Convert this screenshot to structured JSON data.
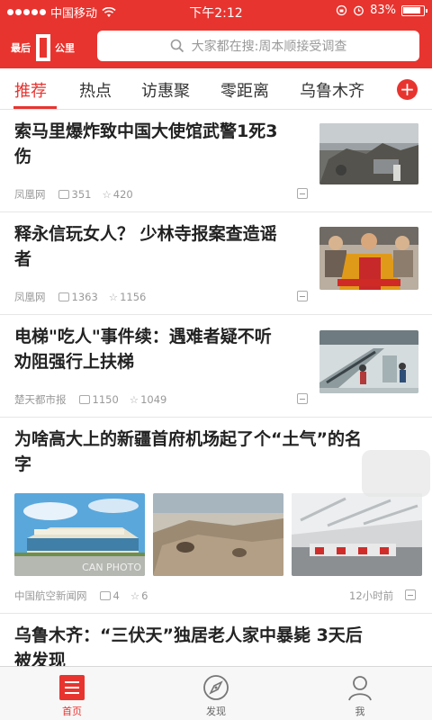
{
  "status_bar": {
    "carrier": "中国移动",
    "time": "下午2:12",
    "battery": "83%",
    "battery_level": 0.83
  },
  "header": {
    "logo_text_left": "最后",
    "logo_text_right": "公里",
    "search_placeholder": "大家都在搜:周本顺接受调查"
  },
  "tabs": [
    {
      "label": "推荐",
      "active": true
    },
    {
      "label": "热点",
      "active": false
    },
    {
      "label": "访惠聚",
      "active": false
    },
    {
      "label": "零距离",
      "active": false
    },
    {
      "label": "乌鲁木齐",
      "active": false
    }
  ],
  "accent_color": "#e8342f",
  "news": [
    {
      "title_line1": "索马里爆炸致中国大使馆武警1死3",
      "title_line2": "伤",
      "source": "凤凰网",
      "comments": "351",
      "likes": "420"
    },
    {
      "title_line1": "释永信玩女人？ 少林寺报案查造谣",
      "title_line2": "者",
      "source": "凤凰网",
      "comments": "1363",
      "likes": "1156"
    },
    {
      "title_line1": "电梯\"吃人\"事件续：遇难者疑不听",
      "title_line2": "劝阻强行上扶梯",
      "source": "楚天都市报",
      "comments": "1150",
      "likes": "1049"
    },
    {
      "title_line1": "为啥高大上的新疆首府机场起了个“土气”的名",
      "title_line2": "字",
      "source": "中国航空新闻网",
      "comments": "4",
      "likes": "6",
      "time": "12小时前",
      "watermark": "CAN PHOTO"
    },
    {
      "title_line1": "乌鲁木齐：“三伏天”独居老人家中暴毙 3天后",
      "title_line2": "被发现"
    }
  ],
  "bottom_nav": [
    {
      "label": "首页",
      "icon": "home-list-icon",
      "active": true
    },
    {
      "label": "发现",
      "icon": "compass-icon",
      "active": false
    },
    {
      "label": "我",
      "icon": "person-icon",
      "active": false
    }
  ]
}
